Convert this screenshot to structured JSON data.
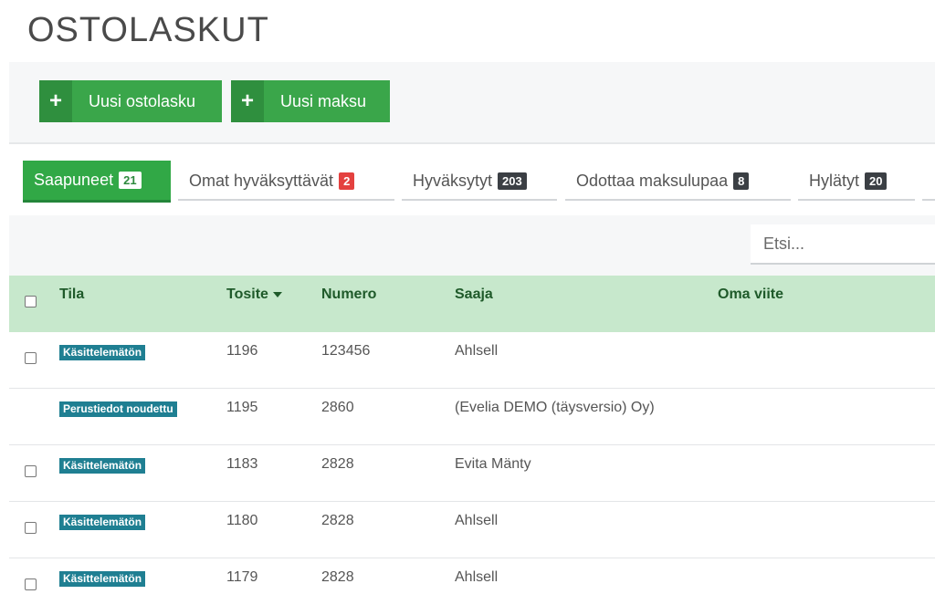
{
  "page": {
    "title": "OSTOLASKUT"
  },
  "toolbar": {
    "buttons": [
      {
        "icon": "plus-icon",
        "label": "Uusi ostolasku"
      },
      {
        "icon": "plus-icon",
        "label": "Uusi maksu"
      }
    ]
  },
  "tabs": [
    {
      "label": "Saapuneet",
      "count": "21",
      "active": true
    },
    {
      "label": "Omat hyväksyttävät",
      "count": "2",
      "badge_color": "#e4413f"
    },
    {
      "label": "Hyväksytyt",
      "count": "203"
    },
    {
      "label": "Odottaa maksulupaa",
      "count": "8"
    },
    {
      "label": "Hylätyt",
      "count": "20"
    }
  ],
  "search": {
    "placeholder": "Etsi..."
  },
  "table": {
    "columns": [
      "Tila",
      "Tosite",
      "Numero",
      "Saaja",
      "Oma viite"
    ],
    "sort_column": "Tosite",
    "rows": [
      {
        "status": "Käsittelemätön",
        "tosite": "1196",
        "numero": "123456",
        "saaja": "Ahlsell",
        "oma_viite": "",
        "checkbox": true
      },
      {
        "status": "Perustiedot noudettu",
        "tosite": "1195",
        "numero": "2860",
        "saaja": "(Evelia DEMO (täysversio) Oy)",
        "oma_viite": "",
        "checkbox": false
      },
      {
        "status": "Käsittelemätön",
        "tosite": "1183",
        "numero": "2828",
        "saaja": "Evita Mänty",
        "oma_viite": "",
        "checkbox": true
      },
      {
        "status": "Käsittelemätön",
        "tosite": "1180",
        "numero": "2828",
        "saaja": "Ahlsell",
        "oma_viite": "",
        "checkbox": true
      },
      {
        "status": "Käsittelemätön",
        "tosite": "1179",
        "numero": "2828",
        "saaja": "Ahlsell",
        "oma_viite": "",
        "checkbox": true
      }
    ]
  },
  "colors": {
    "accent": "#3aa64a",
    "header_bg": "#c7e8cc",
    "status_badge": "#1f7f92"
  }
}
